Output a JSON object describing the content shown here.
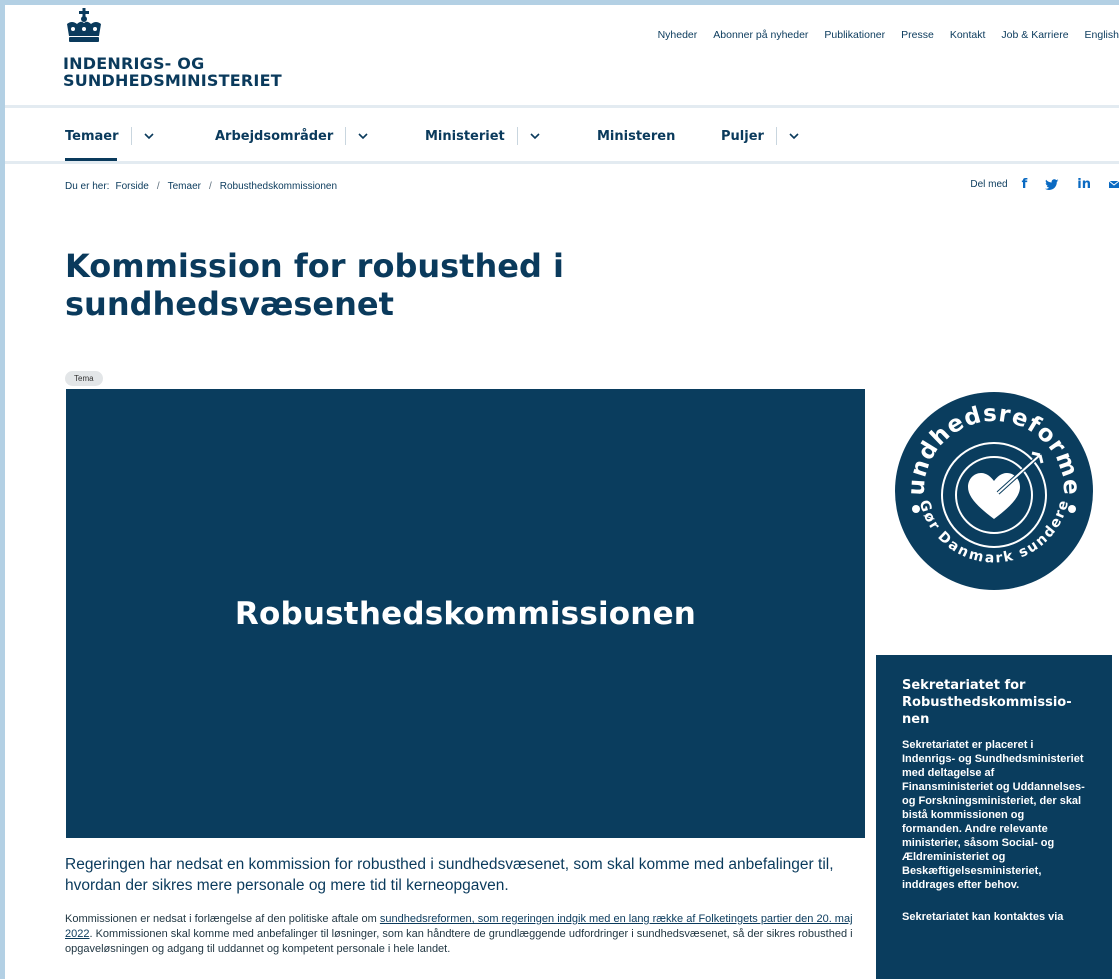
{
  "header": {
    "logo_line1": "INDENRIGS- OG",
    "logo_line2": "SUNDHEDSMINISTERIET",
    "top_links": [
      "Nyheder",
      "Abonner på nyheder",
      "Publikationer",
      "Presse",
      "Kontakt",
      "Job & Karriere",
      "English"
    ]
  },
  "nav": {
    "items": [
      {
        "label": "Temaer",
        "has_dropdown": true,
        "active": true
      },
      {
        "label": "Arbejdsområder",
        "has_dropdown": true
      },
      {
        "label": "Ministeriet",
        "has_dropdown": true
      },
      {
        "label": "Ministeren",
        "has_dropdown": false
      },
      {
        "label": "Puljer",
        "has_dropdown": true
      }
    ]
  },
  "breadcrumb": {
    "prefix": "Du er her:",
    "items": [
      "Forside",
      "Temaer",
      "Robusthedskommissionen"
    ]
  },
  "share": {
    "label": "Del med",
    "icons": [
      "facebook-icon",
      "twitter-icon",
      "linkedin-icon",
      "mail-icon"
    ]
  },
  "page": {
    "title": "Kommission for robusthed i sundhedsvæsenet",
    "tag": "Tema",
    "hero_text": "Robusthedskommissionen",
    "lead": "Regeringen har nedsat en kommission for robusthed i sundhedsvæsenet, som skal komme med anbefalinger til, hvordan der sikres mere personale og mere tid til kerneopgaven.",
    "body_before_link": "Kommissionen er nedsat i forlængelse af den politiske aftale om ",
    "body_link": "sundhedsreformen, som regeringen indgik med en lang række af Folketingets partier den 20. maj 2022",
    "body_after_link": ". Kommissionen skal komme med anbefalinger til løsninger, som kan håndtere de grundlæggende udfordringer i sundhedsvæsenet, så der sikres robusthed i opgaveløsningen og adgang til uddannet og kompetent personale i hele landet."
  },
  "badge": {
    "top_text": "Sundhedsreformen",
    "bottom_text": "Gør Danmark sundere"
  },
  "sidebar": {
    "title": "Sekretariatet for Robusthedskommissio-nen",
    "text": "Sekretariatet er placeret i Indenrigs- og Sundhedsministeriet med deltagelse af Finansministeriet og Uddannelses- og Forskningsministeriet, der skal bistå kommissionen og formanden. Andre relevante ministerier, såsom Social- og Ældreministeriet og Beskæftigelsesministeriet, inddrages efter behov.",
    "text2": "Sekretariatet kan kontaktes via"
  },
  "colors": {
    "primary": "#0a3a5c",
    "hero_bg": "#0a3d5e",
    "frame_bg": "#b3d0e4",
    "share_icon": "#0a6ac2"
  }
}
